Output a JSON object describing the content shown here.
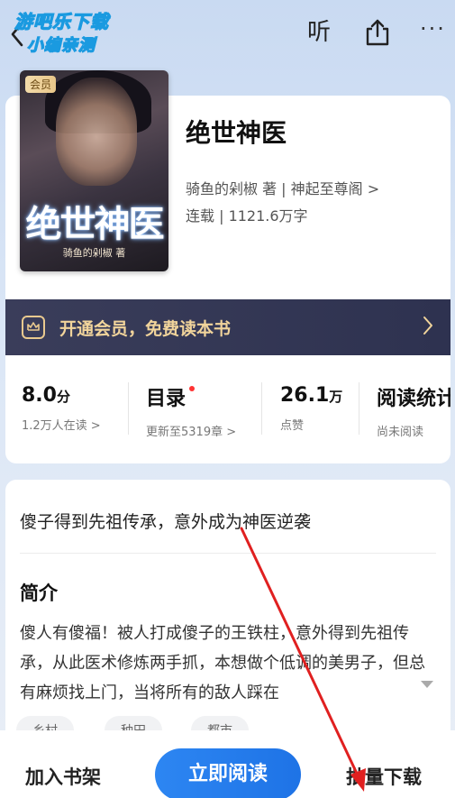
{
  "watermark": {
    "line1": "游吧乐下载",
    "line2": "小编亲测"
  },
  "header": {
    "listen_label": "听",
    "more_label": "···"
  },
  "book": {
    "badge": "会员",
    "cover_title": "绝世神医",
    "cover_author": "骑鱼的剁椒 著",
    "title": "绝世神医",
    "meta_line1": "骑鱼的剁椒 著 | 神起至尊阁 >",
    "meta_line2": "连载 | 1121.6万字"
  },
  "vip_banner": {
    "text": "开通会员，免费读本书"
  },
  "stats": [
    {
      "value": "8.0",
      "unit": "分",
      "sub": "1.2万人在读 >"
    },
    {
      "value": "目录",
      "unit": "",
      "sub": "更新至5319章 >"
    },
    {
      "value": "26.1",
      "unit": "万",
      "sub": "点赞"
    },
    {
      "value": "阅读统计",
      "unit": "",
      "sub": "尚未阅读"
    }
  ],
  "intro": {
    "tagline": "傻子得到先祖传承，意外成为神医逆袭",
    "heading": "简介",
    "body": "傻人有傻福！被人打成傻子的王铁柱，意外得到先祖传承，从此医术修炼两手抓，本想做个低调的美男子，但总有麻烦找上门，当将所有的敌人踩在",
    "tags": [
      "乡村",
      "种田",
      "都市"
    ]
  },
  "bottom_bar": {
    "shelf_label": "加入书架",
    "read_label": "立即阅读",
    "download_label": "批量下载"
  },
  "colors": {
    "accent_blue": "#1e73e6",
    "vip_bg": "#2e3250",
    "vip_gold": "#f1d49b",
    "annotation_red": "#e02020"
  }
}
